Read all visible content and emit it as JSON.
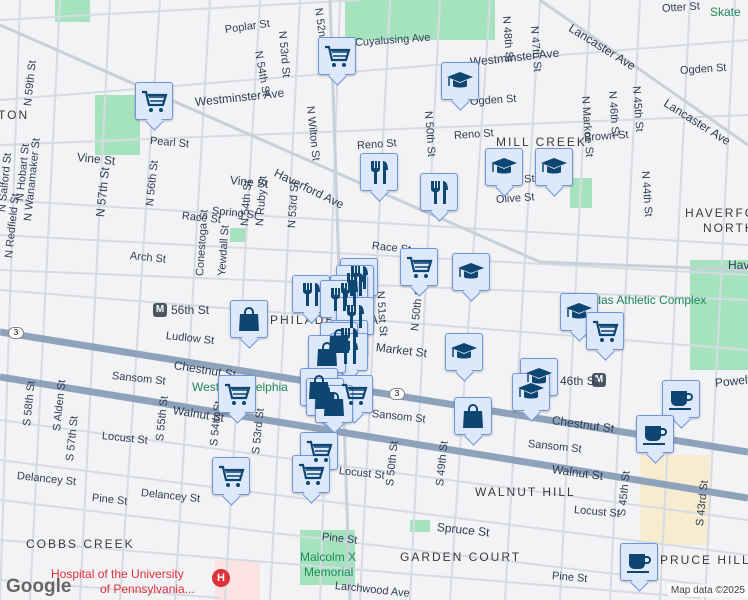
{
  "streets": [
    "Poplar St",
    "N 54th St",
    "N 53rd St",
    "N 52nd St",
    "Westminster Ave",
    "Westminster Ave",
    "N Wilton St",
    "Pearl St",
    "Vine St",
    "Vine St",
    "Haverford Ave",
    "N 59th St",
    "N 57th St",
    "N 56th St",
    "Spring St",
    "Race St",
    "N Salford St",
    "N Redfield St",
    "N Hobart St",
    "N Wanamaker St",
    "N 54th St",
    "N Ruby St",
    "N 53rd St",
    "Conestoga St",
    "Yewdall St",
    "Arch St",
    "Race St",
    "Ludlow St",
    "Chestnut St",
    "Sansom St",
    "Walnut St",
    "S 58th St",
    "S Alden St",
    "S 57th St",
    "Locust St",
    "S 55th St",
    "S 54th St",
    "S 53rd St",
    "Delancey St",
    "Delancey St",
    "Pine St",
    "Pine St",
    "Larchwood Ave",
    "Lancaster Ave",
    "Lancaster Ave",
    "Otter St",
    "Ogden St",
    "Ogden St",
    "N 47th St",
    "N 48th St",
    "N 50th St",
    "Reno St",
    "Brown St",
    "N Markoe St",
    "N 46th St",
    "N 45th St",
    "N 44th St",
    "Olive St",
    "Aspen St",
    "Market St",
    "N 50th St",
    "Chestnut St",
    "Sansom St",
    "Walnut St",
    "S 50th St",
    "S 49th St",
    "Locust St",
    "Spruce St",
    "S 45th St",
    "S 43rd St",
    "Pine St",
    "Sansom St",
    "Powelton Ave",
    "Havertford Ave",
    "Locust St",
    "N 51st St",
    "Reno St",
    "Cuyalusing Ave"
  ],
  "neighborhoods": [
    "MILL CREEK",
    "HAVERFORD",
    "NORTH",
    "PHILADELPHIA",
    "WALNUT HILL",
    "GARDEN COURT",
    "SPRUCE HILL",
    "COBBS CREEK",
    "TON"
  ],
  "places": {
    "skate": "Skate",
    "athletic": "Odas Athletic Complex",
    "west_phila": "West Philadelphia",
    "malcolm": "Malcolm X",
    "malcolm2": "Memorial",
    "hospital1": "Hospital of the University",
    "hospital2": "of Pennsylvania..."
  },
  "transit": {
    "station1": "56th St",
    "station2": "46th St",
    "route": "3"
  },
  "attribution": "Map data ©2025",
  "logo": "Google",
  "colors": {
    "pin_bg": "#dde8fb",
    "pin_border": "#6e96da",
    "icon": "#0d4670",
    "major_road": "#8ea3bb",
    "park": "#a5e3bf"
  }
}
